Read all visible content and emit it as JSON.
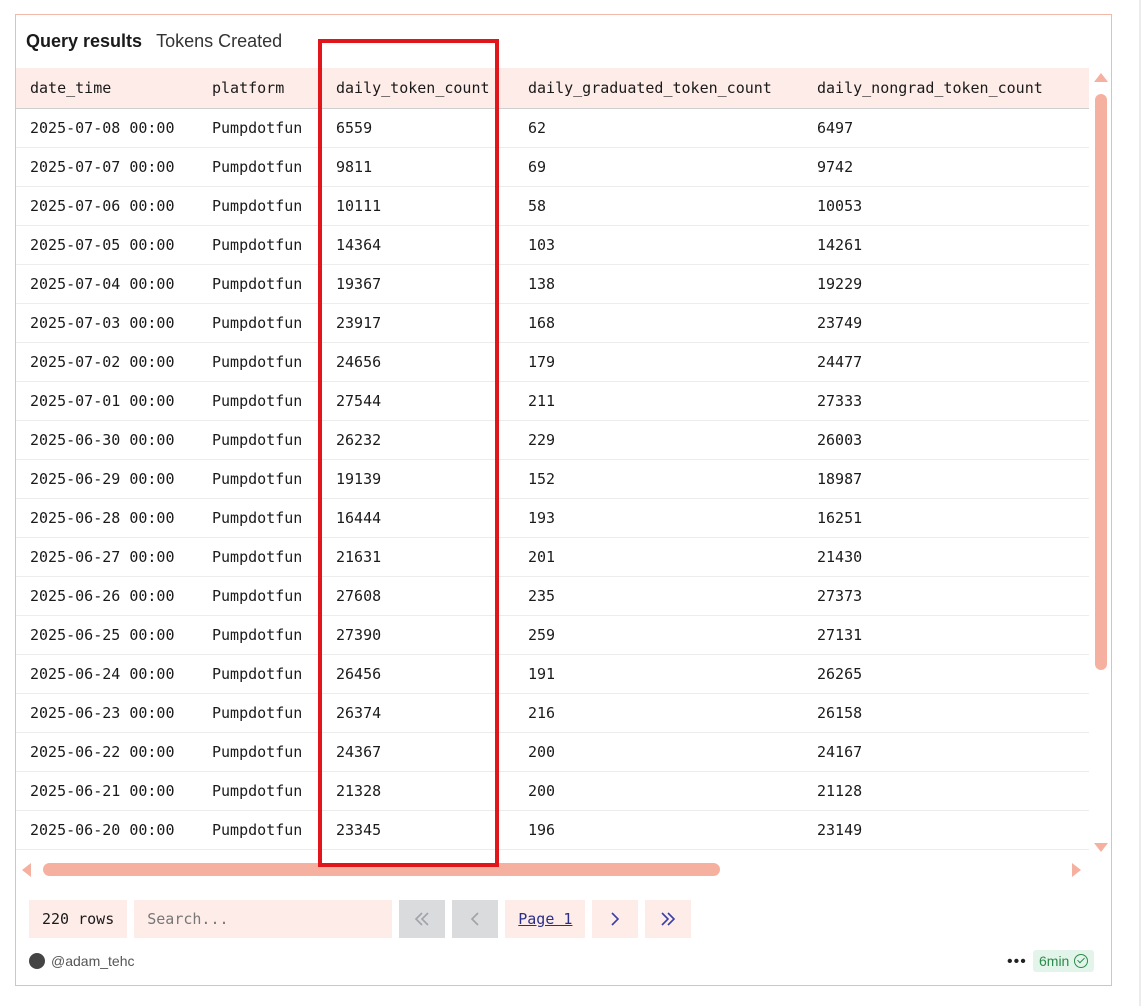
{
  "header": {
    "label": "Query results",
    "title": "Tokens Created"
  },
  "table": {
    "columns": [
      "date_time",
      "platform",
      "daily_token_count",
      "daily_graduated_token_count",
      "daily_nongrad_token_count"
    ],
    "rows": [
      [
        "2025-07-08 00:00",
        "Pumpdotfun",
        "6559",
        "62",
        "6497"
      ],
      [
        "2025-07-07 00:00",
        "Pumpdotfun",
        "9811",
        "69",
        "9742"
      ],
      [
        "2025-07-06 00:00",
        "Pumpdotfun",
        "10111",
        "58",
        "10053"
      ],
      [
        "2025-07-05 00:00",
        "Pumpdotfun",
        "14364",
        "103",
        "14261"
      ],
      [
        "2025-07-04 00:00",
        "Pumpdotfun",
        "19367",
        "138",
        "19229"
      ],
      [
        "2025-07-03 00:00",
        "Pumpdotfun",
        "23917",
        "168",
        "23749"
      ],
      [
        "2025-07-02 00:00",
        "Pumpdotfun",
        "24656",
        "179",
        "24477"
      ],
      [
        "2025-07-01 00:00",
        "Pumpdotfun",
        "27544",
        "211",
        "27333"
      ],
      [
        "2025-06-30 00:00",
        "Pumpdotfun",
        "26232",
        "229",
        "26003"
      ],
      [
        "2025-06-29 00:00",
        "Pumpdotfun",
        "19139",
        "152",
        "18987"
      ],
      [
        "2025-06-28 00:00",
        "Pumpdotfun",
        "16444",
        "193",
        "16251"
      ],
      [
        "2025-06-27 00:00",
        "Pumpdotfun",
        "21631",
        "201",
        "21430"
      ],
      [
        "2025-06-26 00:00",
        "Pumpdotfun",
        "27608",
        "235",
        "27373"
      ],
      [
        "2025-06-25 00:00",
        "Pumpdotfun",
        "27390",
        "259",
        "27131"
      ],
      [
        "2025-06-24 00:00",
        "Pumpdotfun",
        "26456",
        "191",
        "26265"
      ],
      [
        "2025-06-23 00:00",
        "Pumpdotfun",
        "26374",
        "216",
        "26158"
      ],
      [
        "2025-06-22 00:00",
        "Pumpdotfun",
        "24367",
        "200",
        "24167"
      ],
      [
        "2025-06-21 00:00",
        "Pumpdotfun",
        "21328",
        "200",
        "21128"
      ],
      [
        "2025-06-20 00:00",
        "Pumpdotfun",
        "23345",
        "196",
        "23149"
      ]
    ]
  },
  "footer": {
    "rows_label": "220 rows",
    "search_placeholder": "Search...",
    "page_label": "Page 1",
    "author": "@adam_tehc",
    "more_label": "•••",
    "age_badge": "6min"
  },
  "colors": {
    "accent": "#f6b0a0",
    "header_bg": "#fdece7",
    "highlight": "#e0161a",
    "badge": "#2c8a4a"
  },
  "icons": [
    "first-page-icon",
    "prev-page-icon",
    "next-page-icon",
    "last-page-icon",
    "check-circle-icon",
    "more-icon",
    "avatar"
  ]
}
